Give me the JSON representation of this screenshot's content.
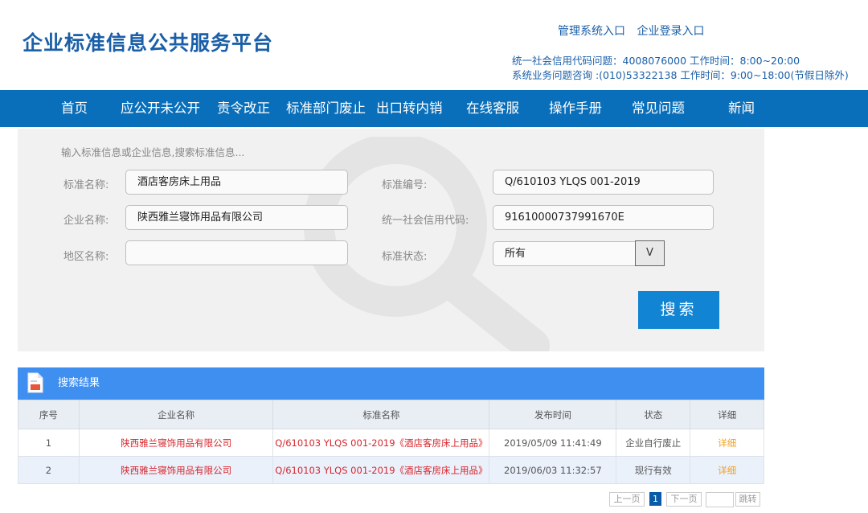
{
  "header": {
    "logo": "企业标准信息公共服务平台",
    "links": [
      "管理系统入口",
      "企业登录入口"
    ],
    "info_line1": "统一社会信用代码问题：4008076000 工作时间：8:00~20:00",
    "info_line2": "系统业务问题咨询 :(010)53322138 工作时间：9:00~18:00(节假日除外)"
  },
  "nav": {
    "items": [
      "首页",
      "应公开未公开",
      "责令改正",
      "标准部门废止",
      "出口转内销",
      "在线客服",
      "操作手册",
      "常见问题",
      "新闻"
    ]
  },
  "search": {
    "hint": "输入标准信息或企业信息,搜索标准信息...",
    "std_name_label": "标准名称:",
    "std_name_value": "酒店客房床上用品",
    "std_no_label": "标准编号:",
    "std_no_value": "Q/610103 YLQS 001-2019",
    "company_label": "企业名称:",
    "company_value": "陕西雅兰寝饰用品有限公司",
    "credit_label": "统一社会信用代码:",
    "credit_value": "91610000737991670E",
    "region_label": "地区名称:",
    "region_value": "",
    "status_label": "标准状态:",
    "status_value": "所有",
    "dropdown_glyph": "V",
    "button_label": "搜索"
  },
  "results": {
    "title": "搜索结果",
    "columns": [
      "序号",
      "企业名称",
      "标准名称",
      "发布时间",
      "状态",
      "详细"
    ],
    "rows": [
      [
        "1",
        "陕西雅兰寝饰用品有限公司",
        "Q/610103 YLQS 001-2019《酒店客房床上用品》",
        "2019/05/09 11:41:49",
        "企业自行废止",
        "详细"
      ],
      [
        "2",
        "陕西雅兰寝饰用品有限公司",
        "Q/610103 YLQS 001-2019《酒店客房床上用品》",
        "2019/06/03 11:32:57",
        "现行有效",
        "详细"
      ]
    ]
  },
  "pager": {
    "prev": "上一页",
    "current": "1",
    "next": "下一页",
    "jump": "跳转"
  },
  "colors": {
    "nav_bg": "#0a6fba",
    "brand_blue": "#1a5fa8",
    "button_blue": "#1185d4",
    "results_header": "#3f8ff0",
    "link_red": "#d7262c",
    "detail_orange": "#f2a01f"
  },
  "icons": {
    "magnifier_watermark": "magnifier-watermark-icon",
    "results_doc": "document-icon"
  }
}
